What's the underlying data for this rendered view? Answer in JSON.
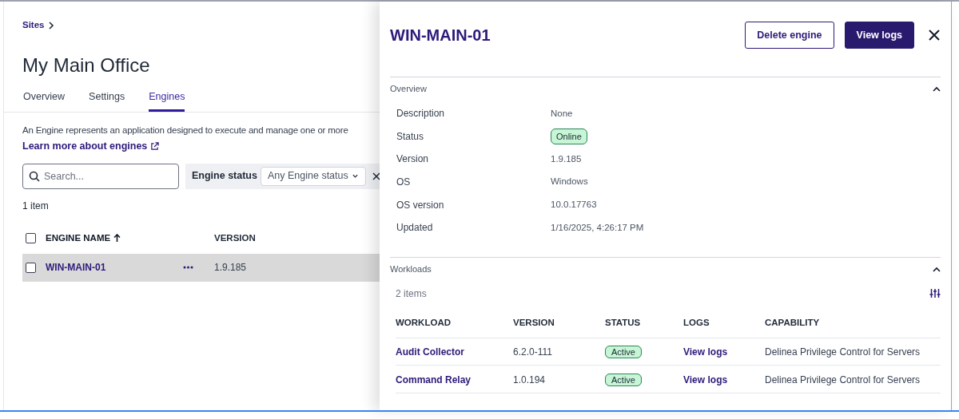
{
  "breadcrumb": [
    {
      "label": "Sites"
    }
  ],
  "page_title": "My Main Office",
  "tabs": [
    {
      "label": "Overview",
      "selected": false
    },
    {
      "label": "Settings",
      "selected": false
    },
    {
      "label": "Engines",
      "selected": true
    }
  ],
  "description": "An Engine represents an application designed to execute and manage one or more",
  "learn_more_link": "Learn more about engines",
  "search": {
    "placeholder": "Search..."
  },
  "filter": {
    "label": "Engine status",
    "value": "Any Engine status"
  },
  "item_count": "1 item",
  "engines_table": {
    "header_checked": false,
    "columns": [
      {
        "label": "ENGINE NAME",
        "sorted": true
      },
      {
        "label": "VERSION",
        "sorted": false
      }
    ],
    "rows": [
      {
        "checked": false,
        "selected": true,
        "name": "WIN-MAIN-01",
        "version": "1.9.185"
      }
    ]
  },
  "detail_panel": {
    "title": "WIN-MAIN-01",
    "buttons": [
      {
        "label": "Delete engine",
        "kind": "outline"
      },
      {
        "label": "View logs",
        "kind": "primary"
      }
    ],
    "overview": {
      "title": "Overview",
      "expanded": true,
      "fields": [
        {
          "label": "Description",
          "value": "None",
          "kind": "text"
        },
        {
          "label": "Status",
          "value": "Online",
          "kind": "badge"
        },
        {
          "label": "Version",
          "value": "1.9.185",
          "kind": "text"
        },
        {
          "label": "OS",
          "value": "Windows",
          "kind": "text"
        },
        {
          "label": "OS version",
          "value": "10.0.17763",
          "kind": "text"
        },
        {
          "label": "Updated",
          "value": "1/16/2025, 4:26:17 PM",
          "kind": "text"
        }
      ]
    },
    "workloads": {
      "title": "Workloads",
      "expanded": true,
      "item_count": "2 items",
      "columns": [
        "WORKLOAD",
        "VERSION",
        "STATUS",
        "LOGS",
        "CAPABILITY"
      ],
      "rows": [
        {
          "workload": "Audit Collector",
          "version": "6.2.0-111",
          "status": "Active",
          "logs": "View logs",
          "capability": "Delinea Privilege Control for Servers"
        },
        {
          "workload": "Command Relay",
          "version": "1.0.194",
          "status": "Active",
          "logs": "View logs",
          "capability": "Delinea Privilege Control for Servers"
        }
      ]
    }
  }
}
